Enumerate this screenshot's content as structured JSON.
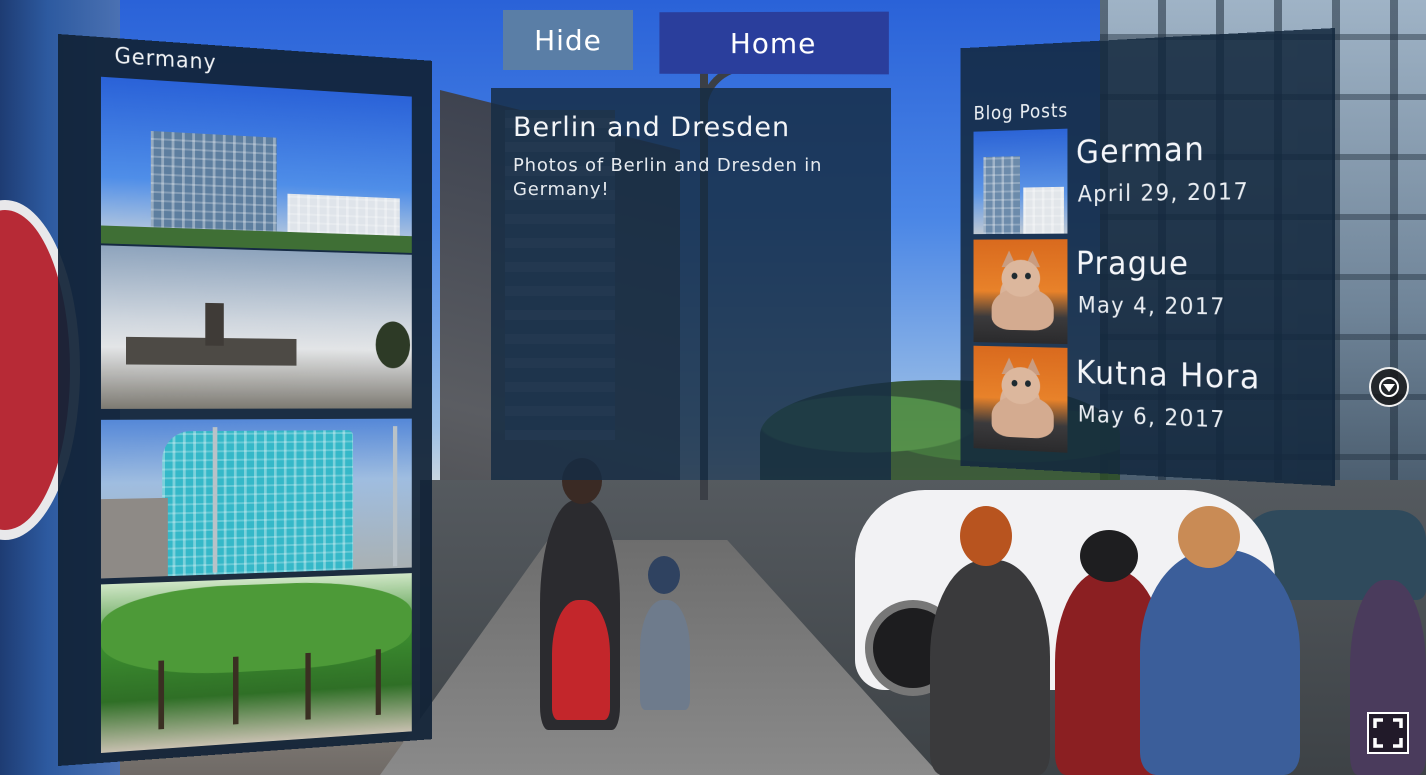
{
  "gallery": {
    "title": "Germany",
    "photos": [
      {
        "icon": "city-towers-photo"
      },
      {
        "icon": "memorial-photo"
      },
      {
        "icon": "blue-building-photo"
      },
      {
        "icon": "trees-photo"
      }
    ]
  },
  "toolbar": {
    "hide_label": "Hide",
    "home_label": "Home"
  },
  "post": {
    "title": "Berlin and Dresden",
    "description": "Photos of Berlin and Dresden in Germany!"
  },
  "blog": {
    "title": "Blog Posts",
    "items": [
      {
        "name": "German",
        "date": "April 29, 2017",
        "thumb": "city"
      },
      {
        "name": "Prague",
        "date": "May 4, 2017",
        "thumb": "cat"
      },
      {
        "name": "Kutna Hora",
        "date": "May 6, 2017",
        "thumb": "cat"
      }
    ]
  },
  "controls": {
    "cursor_icon": "vr-cursor-icon",
    "fullscreen_icon": "fullscreen-icon"
  },
  "colors": {
    "panel": "#14283e",
    "hide_button": "#5a7ea6",
    "home_button": "#2a3e9c"
  }
}
